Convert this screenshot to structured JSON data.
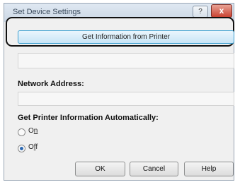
{
  "dialog": {
    "title": "Set Device Settings",
    "titlebar_help": "?",
    "titlebar_close": "x"
  },
  "get_info_button": "Get Information from Printer",
  "network_address": {
    "label": "Network Address:",
    "value": ""
  },
  "auto_info": {
    "label": "Get Printer Information Automatically:",
    "options": [
      {
        "prefix": "O",
        "mnemonic": "n",
        "suffix": "",
        "selected": false
      },
      {
        "prefix": "O",
        "mnemonic": "f",
        "suffix": "f",
        "selected": true
      }
    ]
  },
  "buttons": {
    "ok": "OK",
    "cancel": "Cancel",
    "help": "Help"
  }
}
